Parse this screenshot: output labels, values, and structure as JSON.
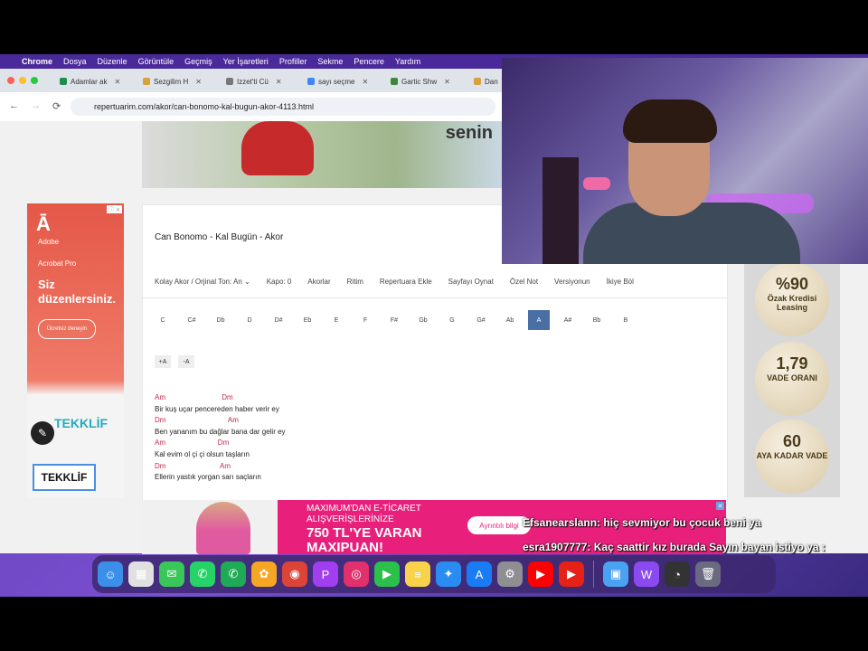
{
  "menubar": {
    "apple": "",
    "items": [
      "Chrome",
      "Dosya",
      "Düzenle",
      "Görüntüle",
      "Geçmiş",
      "Yer İşaretleri",
      "Profiller",
      "Sekme",
      "Pencere",
      "Yardım"
    ]
  },
  "tabs": [
    {
      "label": "Adamlar ak"
    },
    {
      "label": "Sezgilim H"
    },
    {
      "label": "Izzet'ti Cü"
    },
    {
      "label": "sayı seçme"
    },
    {
      "label": "Gartic Shw"
    },
    {
      "label": "Dan"
    }
  ],
  "address": {
    "url": "repertuarim.com/akor/can-bonomo-kal-bugun-akor-4113.html",
    "back": "←",
    "forward": "→",
    "reload": "⟳"
  },
  "top_banner": {
    "headline": "senin"
  },
  "left_ad": {
    "brand": "Adobe",
    "product": "Acrobat Pro",
    "headline": "Siz düzenlersiniz.",
    "cta": "Ücretsiz deneyin",
    "badge": "ⓘ ✕",
    "tekklif_top": "TEKKLİF",
    "tekklif_selected": "TEKKLİF"
  },
  "song": {
    "title": "Can Bonomo - Kal Bugün - Akor",
    "toolbar": [
      "Kolay Akor / Orjinal Ton: An ⌄",
      "Kapo: 0",
      "Akorlar",
      "Ritim",
      "Repertuara Ekle",
      "Sayfayı Oynat",
      "Özel Not",
      "Versiyonun",
      "İkiye Böl"
    ],
    "keys": [
      "C",
      "C#",
      "Db",
      "D",
      "D#",
      "Eb",
      "E",
      "F",
      "F#",
      "Gb",
      "G",
      "G#",
      "Ab",
      "A",
      "A#",
      "Bb",
      "B"
    ],
    "active_key": "A",
    "transpose": [
      "+A",
      "-A"
    ],
    "lyrics": [
      {
        "chords": "Am                            Dm",
        "text": "Bir kuş uçar pencereden haber verir ey"
      },
      {
        "chords": "Dm                               Am",
        "text": "Ben yananım bu dağlar bana dar gelir ey"
      },
      {
        "chords": "Am                          Dm",
        "text": "Kal evim ol çi çi olsun taşların"
      },
      {
        "chords": "Dm                           Am",
        "text": "Ellerin yastık yorgan sarı saçların"
      }
    ]
  },
  "right_ad": {
    "coin1": {
      "big": "%90",
      "small": "Özak Kredisi Leasing"
    },
    "coin2": {
      "big": "1,79",
      "small": "VADE ORANI"
    },
    "coin3": {
      "big": "60",
      "small": "AYA KADAR VADE"
    }
  },
  "bottom_ad": {
    "line1": "MAXIMUM'DAN E-TİCARET",
    "line2": "ALIŞVERİŞLERİNİZE",
    "line3": "750 TL'YE VARAN",
    "line4": "MAXIPUAN!",
    "cta": "Ayrıntılı bilgi",
    "close": "✕"
  },
  "chat": [
    {
      "user": "Efsanearslann",
      "message": ": hiç sevmiyor bu çocuk beni ya"
    },
    {
      "user": "esra1907777",
      "message": ": Kaç saattir kız burada Sayın bayan istiyo ya :"
    }
  ],
  "dock": [
    {
      "name": "finder",
      "glyph": "☺",
      "color": "#3b8fe8"
    },
    {
      "name": "launchpad",
      "glyph": "▦",
      "color": "#e0e0e0"
    },
    {
      "name": "messages",
      "glyph": "✉",
      "color": "#3ac75a"
    },
    {
      "name": "whatsapp",
      "glyph": "✆",
      "color": "#25d366"
    },
    {
      "name": "whatsapp-business",
      "glyph": "✆",
      "color": "#1faa55"
    },
    {
      "name": "photos",
      "glyph": "✿",
      "color": "#f5a623"
    },
    {
      "name": "chrome",
      "glyph": "◉",
      "color": "#db4437"
    },
    {
      "name": "picsart",
      "glyph": "P",
      "color": "#a13ff0"
    },
    {
      "name": "instagram",
      "glyph": "◎",
      "color": "#e1306c"
    },
    {
      "name": "facetime",
      "glyph": "▶",
      "color": "#2bc04a"
    },
    {
      "name": "notes",
      "glyph": "≡",
      "color": "#f7d24a"
    },
    {
      "name": "safari",
      "glyph": "✦",
      "color": "#2a8cf0"
    },
    {
      "name": "app-store",
      "glyph": "A",
      "color": "#1a7cf5"
    },
    {
      "name": "settings",
      "glyph": "⚙",
      "color": "#8e8e93"
    },
    {
      "name": "youtube",
      "glyph": "▶",
      "color": "#ff0000"
    },
    {
      "name": "youtube-music",
      "glyph": "▶",
      "color": "#e62117"
    },
    {
      "name": "folder",
      "glyph": "▣",
      "color": "#4aa3f0"
    },
    {
      "name": "webtoon",
      "glyph": "W",
      "color": "#8a4af0"
    },
    {
      "name": "activity-monitor",
      "glyph": "◔",
      "color": "#333333"
    },
    {
      "name": "trash",
      "glyph": "🗑",
      "color": "#6a6a80"
    }
  ]
}
